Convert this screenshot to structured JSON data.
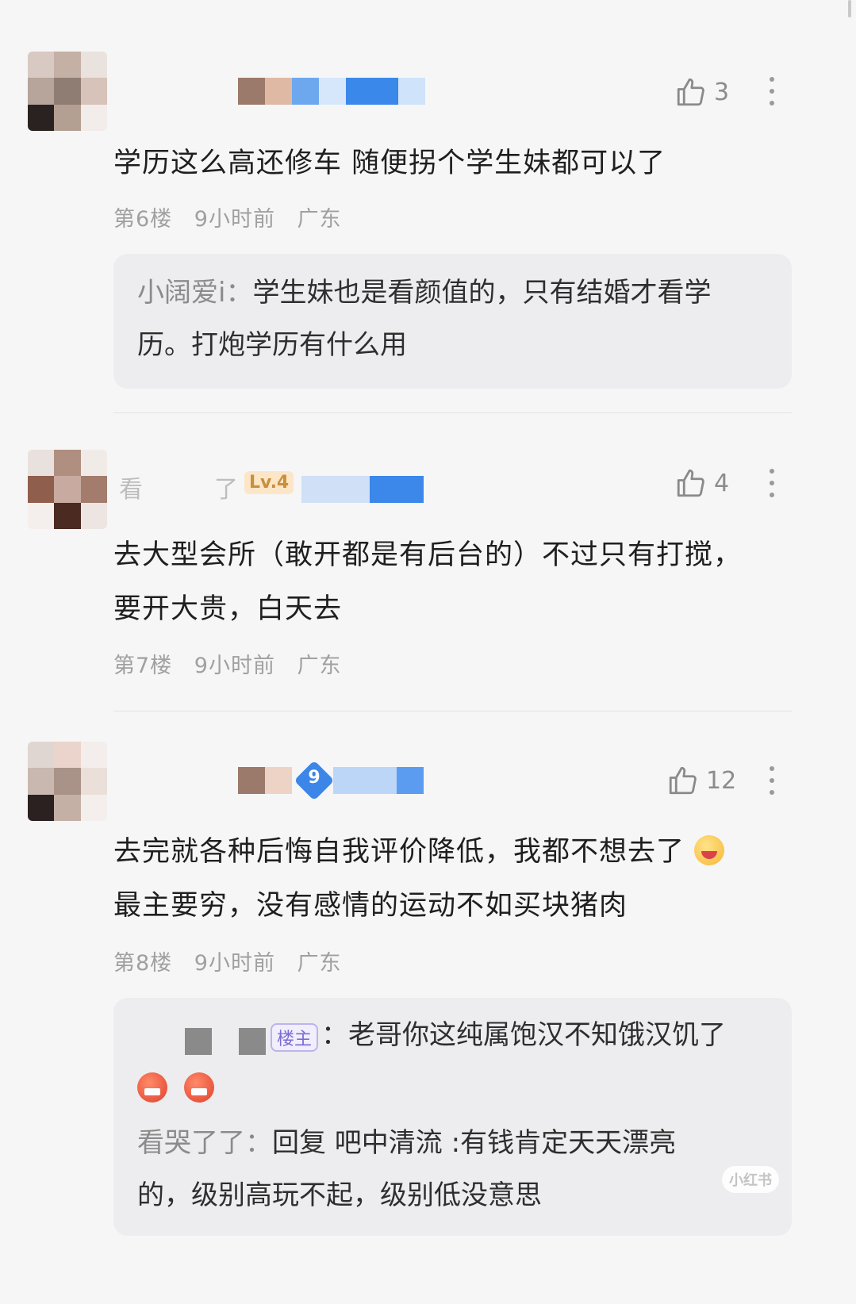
{
  "comments": [
    {
      "text": "学历这么高还修车 随便拐个学生妹都可以了",
      "likes": "3",
      "floor": "第6楼",
      "time": "9小时前",
      "location": "广东",
      "replies": [
        {
          "name": "小阔爱i：",
          "text": "学生妹也是看颜值的，只有结婚才看学",
          "text2": "历。打炮学历有什么用"
        }
      ]
    },
    {
      "name_visible_start": "看",
      "name_visible_end": "了",
      "level": "Lv.4",
      "text": "去大型会所（敢开都是有后台的）不过只有打搅，",
      "text2": "要开大贵，白天去",
      "likes": "4",
      "floor": "第7楼",
      "time": "9小时前",
      "location": "广东"
    },
    {
      "badge_number": "9",
      "text": "去完就各种后悔自我评价降低，我都不想去了",
      "text2": "最主要穷，没有感情的运动不如买块猪肉",
      "likes": "12",
      "floor": "第8楼",
      "time": "9小时前",
      "location": "广东",
      "replies": [
        {
          "owner_badge": "楼主",
          "text": "：老哥你这纯属饱汉不知饿汉饥了"
        },
        {
          "name": "看哭了了：",
          "text": "回复 吧中清流 :有钱肯定天天漂亮",
          "text2": "的，级别高玩不起，级别低没意思"
        }
      ]
    }
  ],
  "watermark": "小红书",
  "icons": [
    "like-thumb-icon",
    "more-dots-icon",
    "laugh-emoji-icon",
    "angry-emoji-icon"
  ]
}
